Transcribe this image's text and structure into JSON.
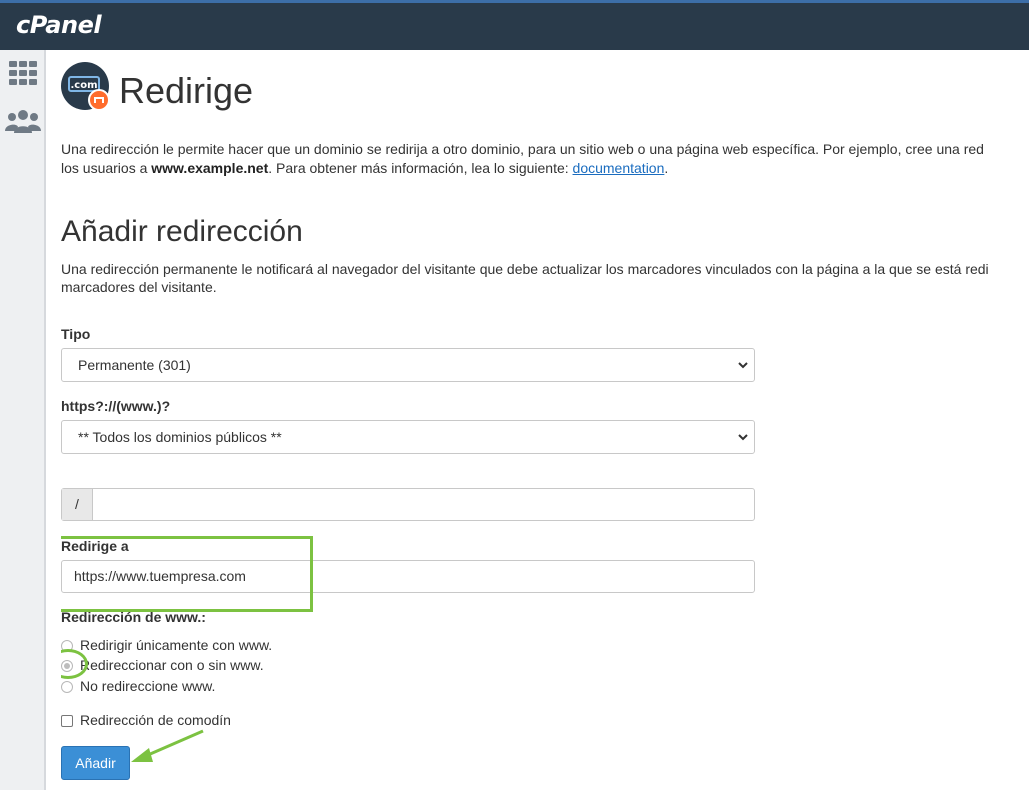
{
  "app": {
    "logo_text": "cPanel"
  },
  "sidebar": {
    "icons": [
      "grid-icon",
      "users-icon"
    ]
  },
  "page": {
    "icon_text": ".com",
    "title": "Redirige",
    "intro_line1": "Una redirección le permite hacer que un dominio se redirija a otro dominio, para un sitio web o una página web específica. Por ejemplo, cree una red",
    "intro_line2_pre": "los usuarios a ",
    "intro_line2_bold": "www.example.net",
    "intro_line2_mid": ". Para obtener más información, lea lo siguiente: ",
    "intro_link": "documentation",
    "intro_end": "."
  },
  "form": {
    "heading": "Añadir redirección",
    "note_line1": "Una redirección permanente le notificará al navegador del visitante que debe actualizar los marcadores vinculados con la página a la que se está redi",
    "note_line2": "marcadores del visitante.",
    "type_label": "Tipo",
    "type_value": "Permanente (301)",
    "domain_label": "https?://(www.)?",
    "domain_value": "** Todos los dominios públicos **",
    "path_prefix": "/",
    "path_value": "",
    "redirect_label": "Redirige a",
    "redirect_value": "https://www.tuempresa.com",
    "www_label": "Redirección de www.:",
    "www_options": [
      {
        "label": "Redirigir únicamente con www.",
        "checked": false
      },
      {
        "label": "Redireccionar con o sin www.",
        "checked": true
      },
      {
        "label": "No redireccione www.",
        "checked": false
      }
    ],
    "wildcard_label": "Redirección de comodín",
    "wildcard_checked": false,
    "submit_label": "Añadir"
  },
  "colors": {
    "topbar": "#293a4a",
    "accent": "#3b8fd6",
    "highlight": "#7cc241",
    "link": "#1a6cbf"
  }
}
